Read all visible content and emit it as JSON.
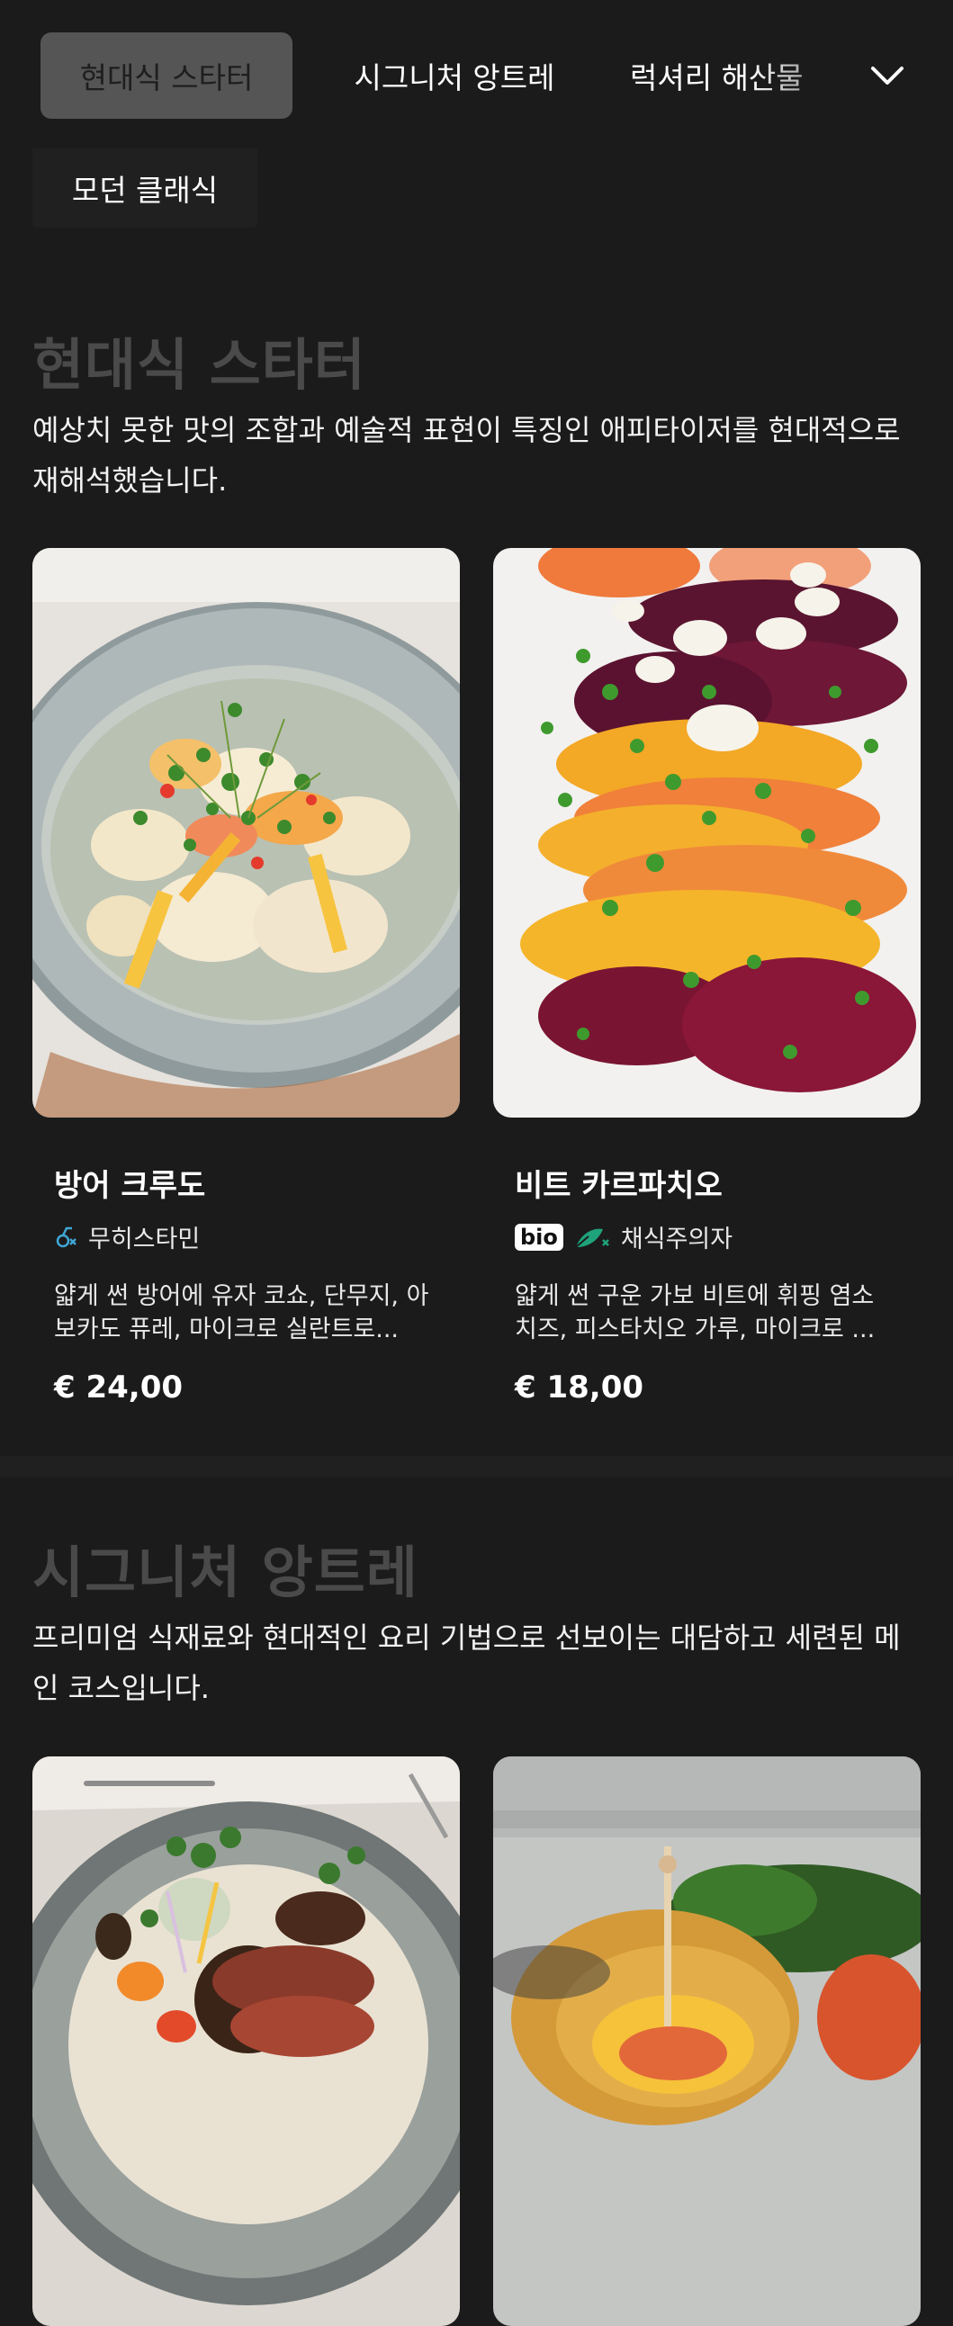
{
  "nav": {
    "tabs": [
      "현대식 스타터",
      "시그니처 앙트레",
      "럭셔리 해산물"
    ],
    "overflow_tab": "모던 클래식",
    "active_index": 0,
    "expand_icon": "chevron-down-icon"
  },
  "sections": [
    {
      "title": "현대식 스타터",
      "description": "예상치 못한 맛의 조합과 예술적 표현이 특징인 애피타이저를 현대적으로 재해석했습니다.",
      "dishes": [
        {
          "name": "방어 크루도",
          "tag_label": "무히스타민",
          "tag_icon": "histamine-free-icon",
          "description": "얇게 썬 방어에 유자 코쇼, 단무지, 아보카도 퓨레, 마이크로 실란트로...",
          "price": "€ 24,00",
          "image": "yellowtail-crudo-photo"
        },
        {
          "name": "비트 카르파치오",
          "bio_label": "bio",
          "tag_label": "채식주의자",
          "tag_icon": "vegetarian-leaf-icon",
          "description": "얇게 썬 구운 가보 비트에 휘핑 염소 치즈, 피스타치오 가루, 마이크로 ...",
          "price": "€ 18,00",
          "image": "beet-carpaccio-photo"
        }
      ]
    },
    {
      "title": "시그니처 앙트레",
      "description": "프리미엄 식재료와 현대적인 요리 기법으로 선보이는 대담하고 세련된 메인 코스입니다.",
      "dishes": [
        {
          "image": "steak-entree-photo"
        },
        {
          "image": "stuffed-bread-photo"
        }
      ]
    }
  ],
  "colors": {
    "background": "#1b1b1b",
    "active_tab": "#555555",
    "section_title": "#4a4a4a",
    "histamine_icon": "#3fa7d6",
    "vegetarian_icon": "#1fa37a"
  }
}
